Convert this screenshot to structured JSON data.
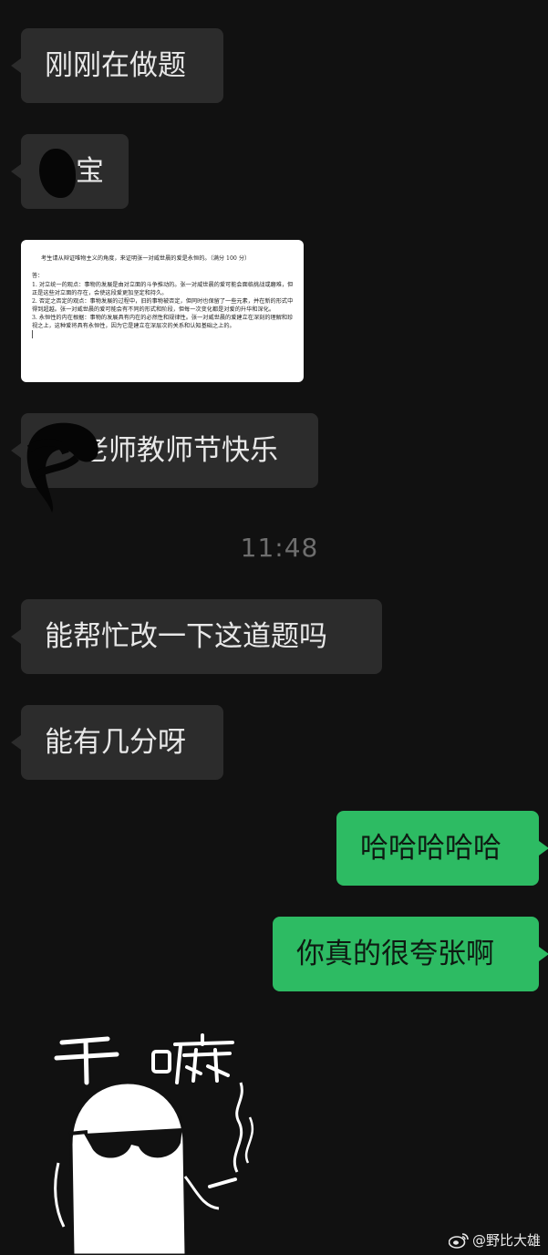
{
  "messages": {
    "m1": "刚刚在做题",
    "m2": "宝",
    "m3": "老师教师节快乐",
    "m4": "能帮忙改一下这道题吗",
    "m5": "能有几分呀",
    "m6": "哈哈哈哈哈",
    "m7": "你真的很夸张啊"
  },
  "timestamp": "11:48",
  "document": {
    "question": "考生请从辩证唯物主义的角度，来证明张一对威世晨的爱是永恒的。（满分 100 分）",
    "answer_head": "答：",
    "points": [
      "1.  对立统一的观点：事物的发展是由对立面的斗争推动的。张一对威世晨的爱可能会面临挑战或磨难，但正是这些对立面的存在，会使这段爱更加坚定和持久。",
      "2.  否定之否定的观点：事物发展的过程中，旧的事物被否定，但同时也保留了一些元素，并在新的形式中得到超越。张一对威世晨的爱可能会有不同的形式和阶段，但每一次变化都是对爱的升华和深化。",
      "3.  永恒性的内在根据：事物的发展具有内在的必然性和规律性。张一对威世晨的爱建立在深刻的理解和珍视之上，这种爱将具有永恒性，因为它是建立在深层次的关系和认知基础之上的。"
    ]
  },
  "sticker": {
    "text_left": "干",
    "text_right": "嘛"
  },
  "watermark": "@野比大雄",
  "colors": {
    "background": "#111111",
    "incoming_bubble": "#2c2c2c",
    "outgoing_bubble": "#2dbb63",
    "timestamp": "#6e6e6e"
  }
}
